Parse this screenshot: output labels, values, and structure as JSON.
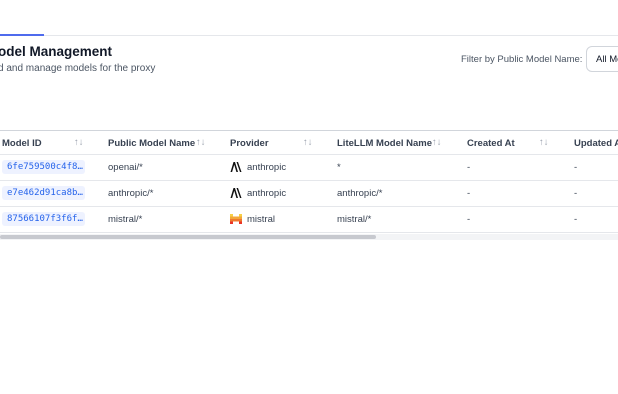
{
  "page": {
    "title": "odel Management",
    "subtitle": "d and manage models for the proxy"
  },
  "filter": {
    "label": "Filter by Public Model Name:",
    "value": "All Mo"
  },
  "table": {
    "columns": [
      {
        "label": "Model ID"
      },
      {
        "label": "Public Model Name"
      },
      {
        "label": "Provider"
      },
      {
        "label": "LiteLLM Model Name"
      },
      {
        "label": "Created At"
      },
      {
        "label": "Updated A"
      }
    ],
    "sort_glyph": "↑↓",
    "rows": [
      {
        "id": "6fe759500c4f8…",
        "public": "openai/*",
        "provider": "anthropic",
        "provider_icon": "anthropic-logo-icon",
        "litellm": "*",
        "created": "-",
        "updated": "-"
      },
      {
        "id": "e7e462d91ca8b…",
        "public": "anthropic/*",
        "provider": "anthropic",
        "provider_icon": "anthropic-logo-icon",
        "litellm": "anthropic/*",
        "created": "-",
        "updated": "-"
      },
      {
        "id": "87566107f3f6f…",
        "public": "mistral/*",
        "provider": "mistral",
        "provider_icon": "mistral-logo-icon",
        "litellm": "mistral/*",
        "created": "-",
        "updated": "-"
      }
    ]
  },
  "colors": {
    "accent": "#4f6bed",
    "id_chip_bg": "#eef2ff",
    "id_chip_text": "#2563eb",
    "mistral_orange": "#f7a823"
  }
}
